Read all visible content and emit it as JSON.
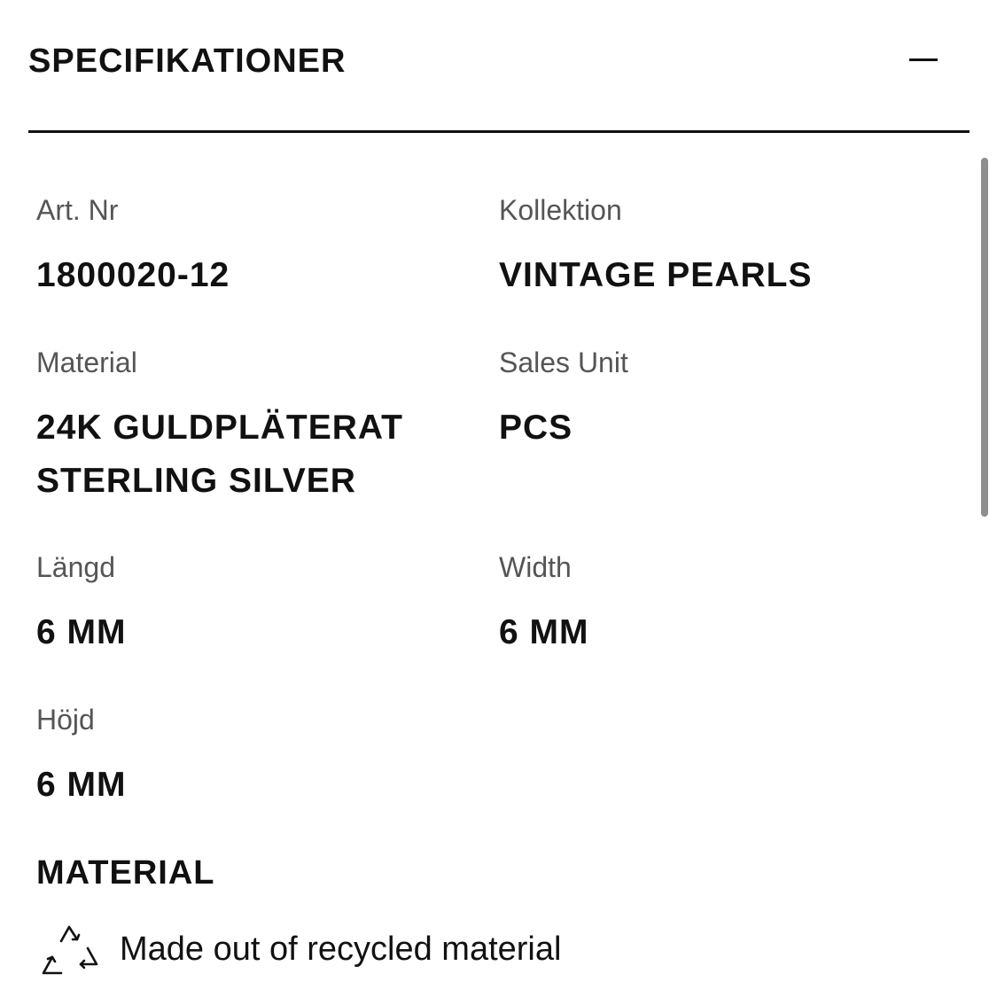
{
  "section": {
    "title": "SPECIFIKATIONER",
    "collapse_icon": "minus-icon"
  },
  "specs": {
    "art_nr": {
      "label": "Art. Nr",
      "value": "1800020-12"
    },
    "kollektion": {
      "label": "Kollektion",
      "value": "VINTAGE PEARLS"
    },
    "material": {
      "label": "Material",
      "value_line1": "24K GULDPLÄTERAT",
      "value_line2": "STERLING SILVER"
    },
    "sales_unit": {
      "label": "Sales Unit",
      "value": "PCS"
    },
    "langd": {
      "label": "Längd",
      "value": "6 MM"
    },
    "width": {
      "label": "Width",
      "value": "6 MM"
    },
    "hojd": {
      "label": "Höjd",
      "value": "6 MM"
    }
  },
  "material_section": {
    "heading": "MATERIAL",
    "icon": "recycle-icon",
    "text": "Made out of recycled material"
  },
  "colors": {
    "text_primary": "#111111",
    "text_label": "#555555",
    "scrollbar": "#8e8e8e"
  }
}
